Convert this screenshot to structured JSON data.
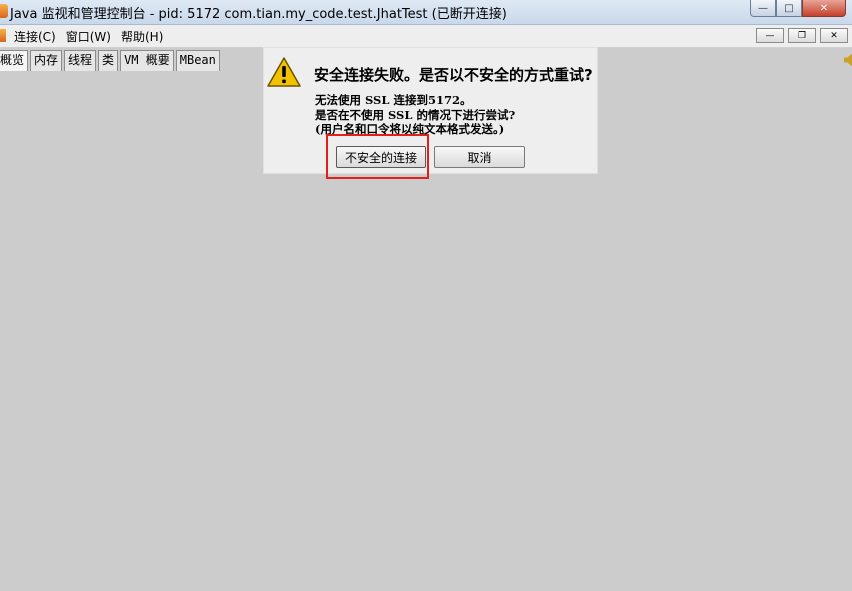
{
  "window": {
    "title": "Java 监视和管理控制台 - pid: 5172 com.tian.my_code.test.JhatTest (已断开连接)",
    "minimize": "—",
    "maximize": "□",
    "close": "✕"
  },
  "menu": {
    "items": [
      "连接(C)",
      "窗口(W)",
      "帮助(H)"
    ],
    "mdi_minimize": "—",
    "mdi_restore": "❐",
    "mdi_close": "✕"
  },
  "tabs": [
    "概览",
    "内存",
    "线程",
    "类",
    "VM 概要",
    "MBean"
  ],
  "dialog": {
    "icon": "warning-icon",
    "title": "安全连接失败。是否以不安全的方式重试?",
    "message_lines": [
      "无法使用 SSL 连接到5172。",
      "是否在不使用 SSL 的情况下进行尝试?",
      "(用户名和口令将以纯文本格式发送。)"
    ],
    "buttons": {
      "insecure": "不安全的连接",
      "cancel": "取消"
    }
  },
  "colors": {
    "background": "#cccccc",
    "dialog_bg": "#eeeeee",
    "highlight": "#e0201a",
    "warning_fill": "#f2c200"
  }
}
